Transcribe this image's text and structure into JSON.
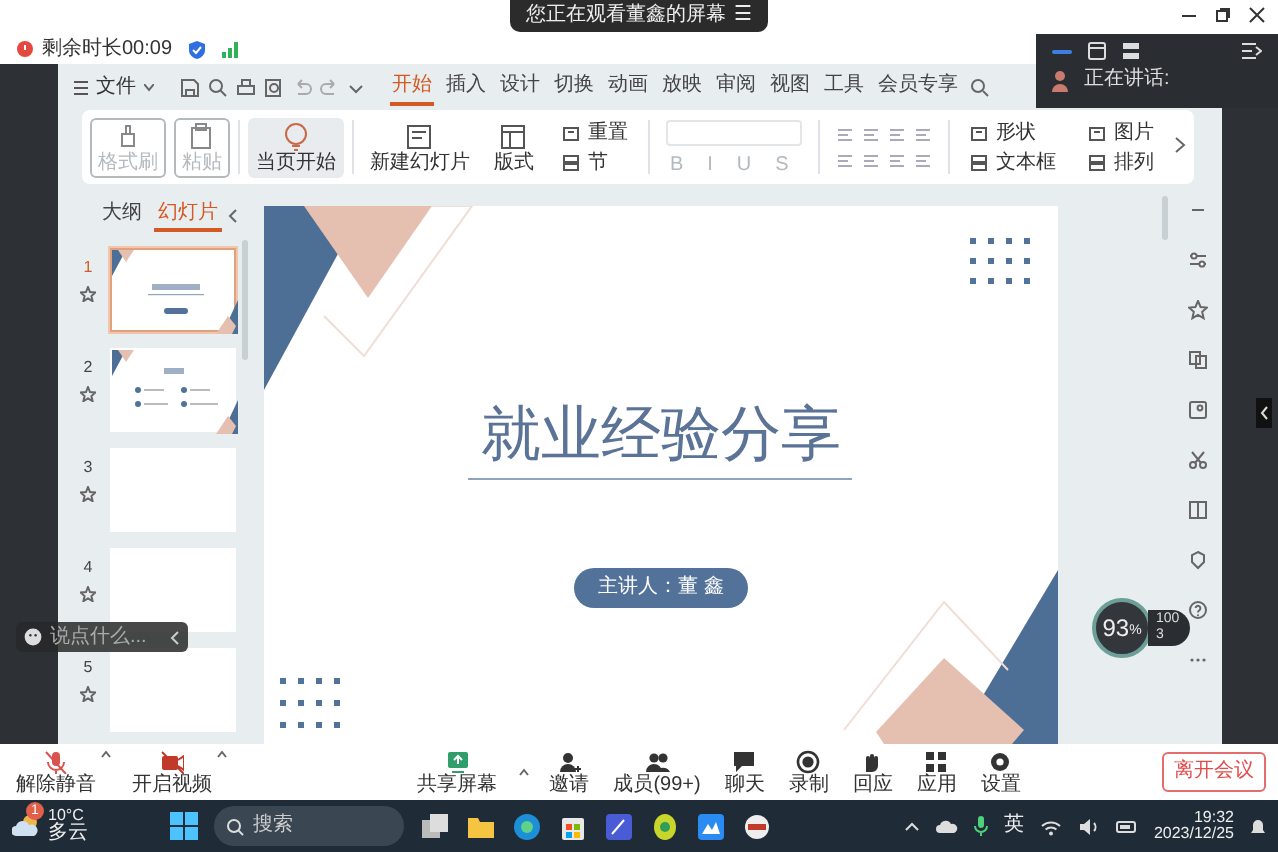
{
  "share_banner": {
    "text": "您正在观看董鑫的屏幕",
    "menu_glyph": "☰"
  },
  "meeting_status": {
    "remaining": "剩余时长00:09"
  },
  "speaker_panel": {
    "label": "正在讲话:"
  },
  "wps": {
    "file_menu": "文件",
    "tabs": [
      {
        "label": "开始",
        "selected": true
      },
      {
        "label": "插入",
        "selected": false
      },
      {
        "label": "设计",
        "selected": false
      },
      {
        "label": "切换",
        "selected": false
      },
      {
        "label": "动画",
        "selected": false
      },
      {
        "label": "放映",
        "selected": false
      },
      {
        "label": "审阅",
        "selected": false
      },
      {
        "label": "视图",
        "selected": false
      },
      {
        "label": "工具",
        "selected": false
      },
      {
        "label": "会员专享",
        "selected": false
      }
    ],
    "ribbon": [
      {
        "kind": "big",
        "label": "格式刷",
        "disabled": true
      },
      {
        "kind": "big",
        "label": "粘贴",
        "disabled": true
      },
      {
        "kind": "big",
        "label": "当页开始",
        "disabled": false
      },
      {
        "kind": "big",
        "label": "新建幻灯片",
        "disabled": false
      },
      {
        "kind": "big",
        "label": "版式",
        "disabled": false
      },
      {
        "kind": "small",
        "label": "重置",
        "disabled": false
      },
      {
        "kind": "small",
        "label": "节",
        "disabled": false
      },
      {
        "kind": "font",
        "glyphs": [
          "B",
          "I",
          "U",
          "S"
        ],
        "disabled": true
      },
      {
        "kind": "small",
        "label": "形状",
        "disabled": false
      },
      {
        "kind": "small",
        "label": "文本框",
        "disabled": false
      },
      {
        "kind": "small",
        "label": "图片",
        "disabled": false
      },
      {
        "kind": "small",
        "label": "排列",
        "disabled": false
      }
    ],
    "panel_tabs": [
      {
        "label": "大纲",
        "selected": false
      },
      {
        "label": "幻灯片",
        "selected": true
      }
    ],
    "slides": [
      {
        "number": "1",
        "kind": "title",
        "selected": true
      },
      {
        "number": "2",
        "kind": "contents",
        "selected": false
      },
      {
        "number": "3",
        "kind": "blank",
        "selected": false
      },
      {
        "number": "4",
        "kind": "blank",
        "selected": false
      },
      {
        "number": "5",
        "kind": "blank",
        "selected": false
      }
    ],
    "slide": {
      "title": "就业经验分享",
      "presenter": "主讲人：董 鑫"
    }
  },
  "chat_input": {
    "placeholder": "说点什么..."
  },
  "speed_meter": {
    "percent": "93",
    "unit": "%",
    "upload": "100",
    "download": "3"
  },
  "meeting_bar": {
    "left": [
      {
        "label": "解除静音",
        "kind": "mic"
      },
      {
        "label": "开启视频",
        "kind": "video"
      }
    ],
    "center": [
      {
        "label": "共享屏幕",
        "kind": "share"
      },
      {
        "label": "邀请",
        "kind": "invite"
      },
      {
        "label": "成员(99+)",
        "kind": "members"
      },
      {
        "label": "聊天",
        "kind": "chat"
      },
      {
        "label": "录制",
        "kind": "record"
      },
      {
        "label": "回应",
        "kind": "react"
      },
      {
        "label": "应用",
        "kind": "apps"
      },
      {
        "label": "设置",
        "kind": "settings"
      }
    ],
    "leave": "离开会议"
  },
  "taskbar": {
    "weather": {
      "badge": "1",
      "temp": "10°C",
      "desc": "多云"
    },
    "search_placeholder": "搜索",
    "ime": "英",
    "time": "19:32",
    "date": "2023/12/25"
  }
}
